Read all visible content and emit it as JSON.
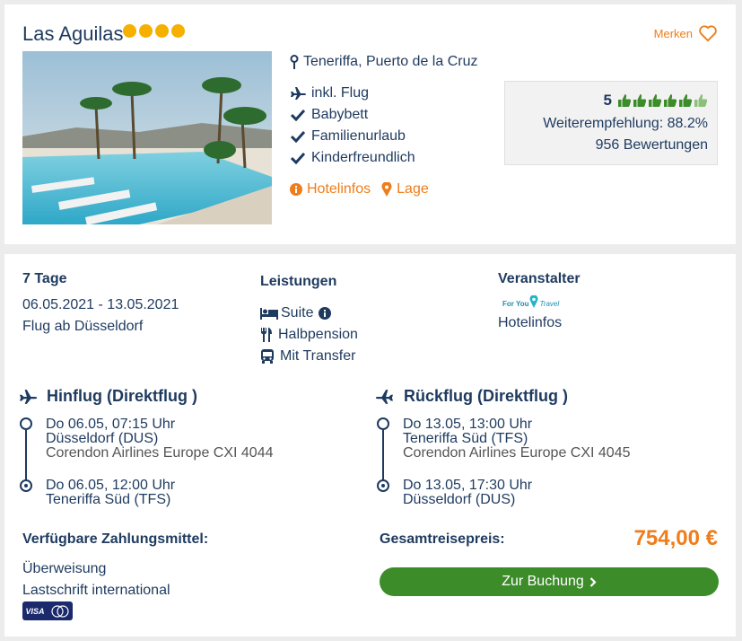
{
  "hotel": {
    "name": "Las Aguilas",
    "stars": 4,
    "location": "Teneriffa, Puerto de la Cruz",
    "features": [
      "inkl. Flug",
      "Babybett",
      "Familienurlaub",
      "Kinderfreundlich"
    ],
    "links": {
      "hotelinfos": "Hotelinfos",
      "lage": "Lage"
    },
    "merken": "Merken"
  },
  "rating": {
    "score": "5",
    "thumbs_full": 5,
    "thumbs_total": 6,
    "recommendation": "Weiterempfehlung: 88.2%",
    "reviews": "956 Bewertungen"
  },
  "trip": {
    "duration": "7 Tage",
    "dates": "06.05.2021 - 13.05.2021",
    "departure": "Flug ab Düsseldorf"
  },
  "services": {
    "heading": "Leistungen",
    "room": "Suite",
    "board": "Halbpension",
    "transfer": "Mit Transfer"
  },
  "operator": {
    "heading": "Veranstalter",
    "logo_text_1": "For You",
    "logo_text_2": "Travel",
    "link": "Hotelinfos"
  },
  "outbound": {
    "title": "Hinflug (Direktflug )",
    "dep_time": "Do 06.05, 07:15 Uhr",
    "dep_airport": "Düsseldorf (DUS)",
    "airline": "Corendon Airlines Europe CXI 4044",
    "arr_time": "Do 06.05, 12:00 Uhr",
    "arr_airport": "Teneriffa Süd (TFS)"
  },
  "return": {
    "title": "Rückflug (Direktflug )",
    "dep_time": "Do 13.05, 13:00 Uhr",
    "dep_airport": "Teneriffa Süd (TFS)",
    "airline": "Corendon Airlines Europe CXI 4045",
    "arr_time": "Do 13.05, 17:30 Uhr",
    "arr_airport": "Düsseldorf (DUS)"
  },
  "payment": {
    "heading": "Verfügbare Zahlungsmittel:",
    "methods": [
      "Überweisung",
      "Lastschrift international"
    ],
    "visa_label": "VISA"
  },
  "price": {
    "label": "Gesamtreisepreis:",
    "value": "754,00 €"
  },
  "booking": {
    "button": "Zur Buchung"
  },
  "colors": {
    "accent": "#ef7d1a",
    "navy": "#1e3a5f",
    "green": "#3d8c2a"
  }
}
